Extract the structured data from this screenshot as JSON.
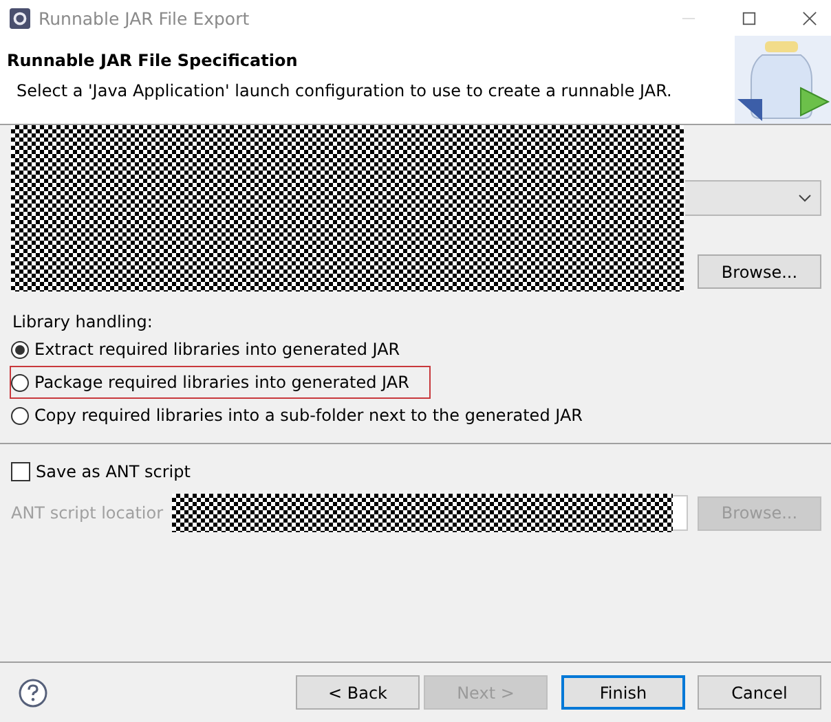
{
  "window": {
    "title": "Runnable JAR File Export"
  },
  "header": {
    "title": "Runnable JAR File Specification",
    "description": "Select a 'Java Application' launch configuration to use to create a runnable JAR."
  },
  "export_destination": {
    "browse_button": {
      "label": "Browse...",
      "disabled": false
    }
  },
  "library_handling": {
    "label": "Library handling:",
    "options": [
      {
        "label": "Extract required libraries into generated JAR",
        "selected": true,
        "highlighted": false
      },
      {
        "label": "Package required libraries into generated JAR",
        "selected": false,
        "highlighted": true
      },
      {
        "label": "Copy required libraries into a sub-folder next to the generated JAR",
        "selected": false,
        "highlighted": false
      }
    ]
  },
  "ant": {
    "checkbox": {
      "label": "Save as ANT script",
      "checked": false
    },
    "location_label": "ANT script locatior",
    "browse_button": {
      "label": "Browse...",
      "disabled": true
    }
  },
  "buttons": [
    {
      "label": "< Back",
      "disabled": false,
      "focused": false
    },
    {
      "label": "Next >",
      "disabled": true,
      "focused": false
    },
    {
      "label": "Finish",
      "disabled": false,
      "focused": true
    },
    {
      "label": "Cancel",
      "disabled": false,
      "focused": false
    }
  ]
}
